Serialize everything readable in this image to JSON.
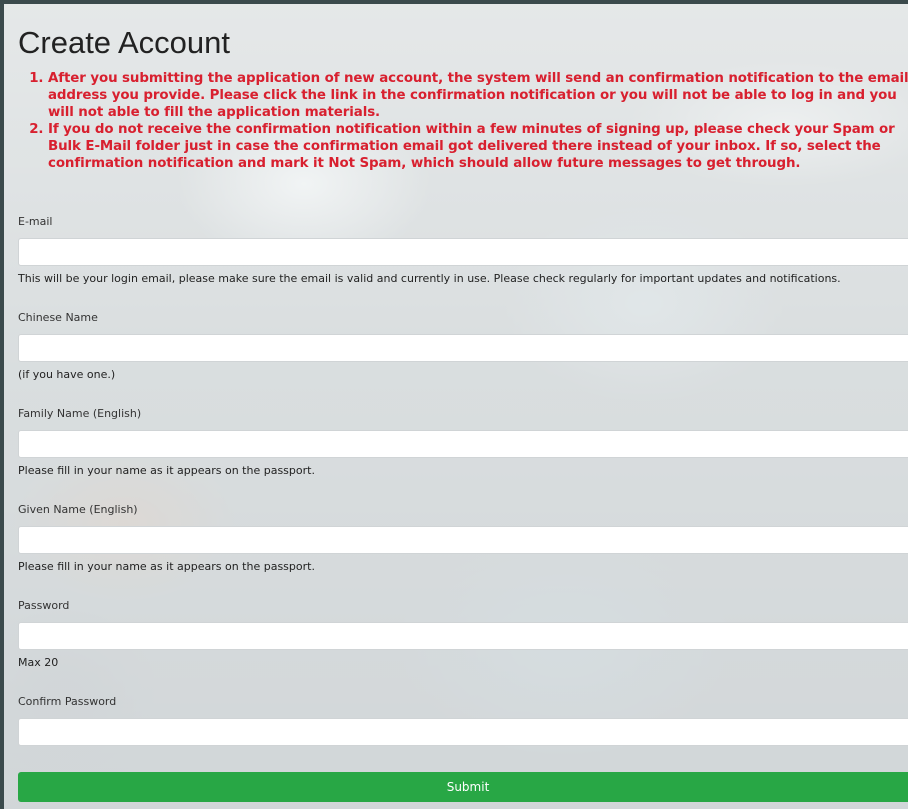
{
  "page": {
    "title": "Create Account",
    "notices": [
      "After you submitting the application of new account, the system will send an confirmation notification to the email address you provide. Please click the link in the confirmation notification or you will not be able to log in and you will not able to fill the application materials.",
      "If you do not receive the confirmation notification within a few minutes of signing up, please check your Spam or Bulk E-Mail folder just in case the confirmation email got delivered there instead of your inbox. If so, select the confirmation notification and mark it Not Spam, which should allow future messages to get through."
    ]
  },
  "form": {
    "email": {
      "label": "E-mail",
      "value": "",
      "help": "This will be your login email, please make sure the email is valid and currently in use. Please check regularly for important updates and notifications."
    },
    "chinese_name": {
      "label": "Chinese Name",
      "value": "",
      "help": "(if you have one.)"
    },
    "family_name": {
      "label": "Family Name (English)",
      "value": "",
      "help": "Please fill in your name as it appears on the passport."
    },
    "given_name": {
      "label": "Given Name (English)",
      "value": "",
      "help": "Please fill in your name as it appears on the passport."
    },
    "password": {
      "label": "Password",
      "value": "",
      "help": "Max 20"
    },
    "confirm_password": {
      "label": "Confirm Password",
      "value": ""
    },
    "submit_label": "Submit"
  },
  "colors": {
    "notice": "#d8202f",
    "submit": "#28a745"
  }
}
